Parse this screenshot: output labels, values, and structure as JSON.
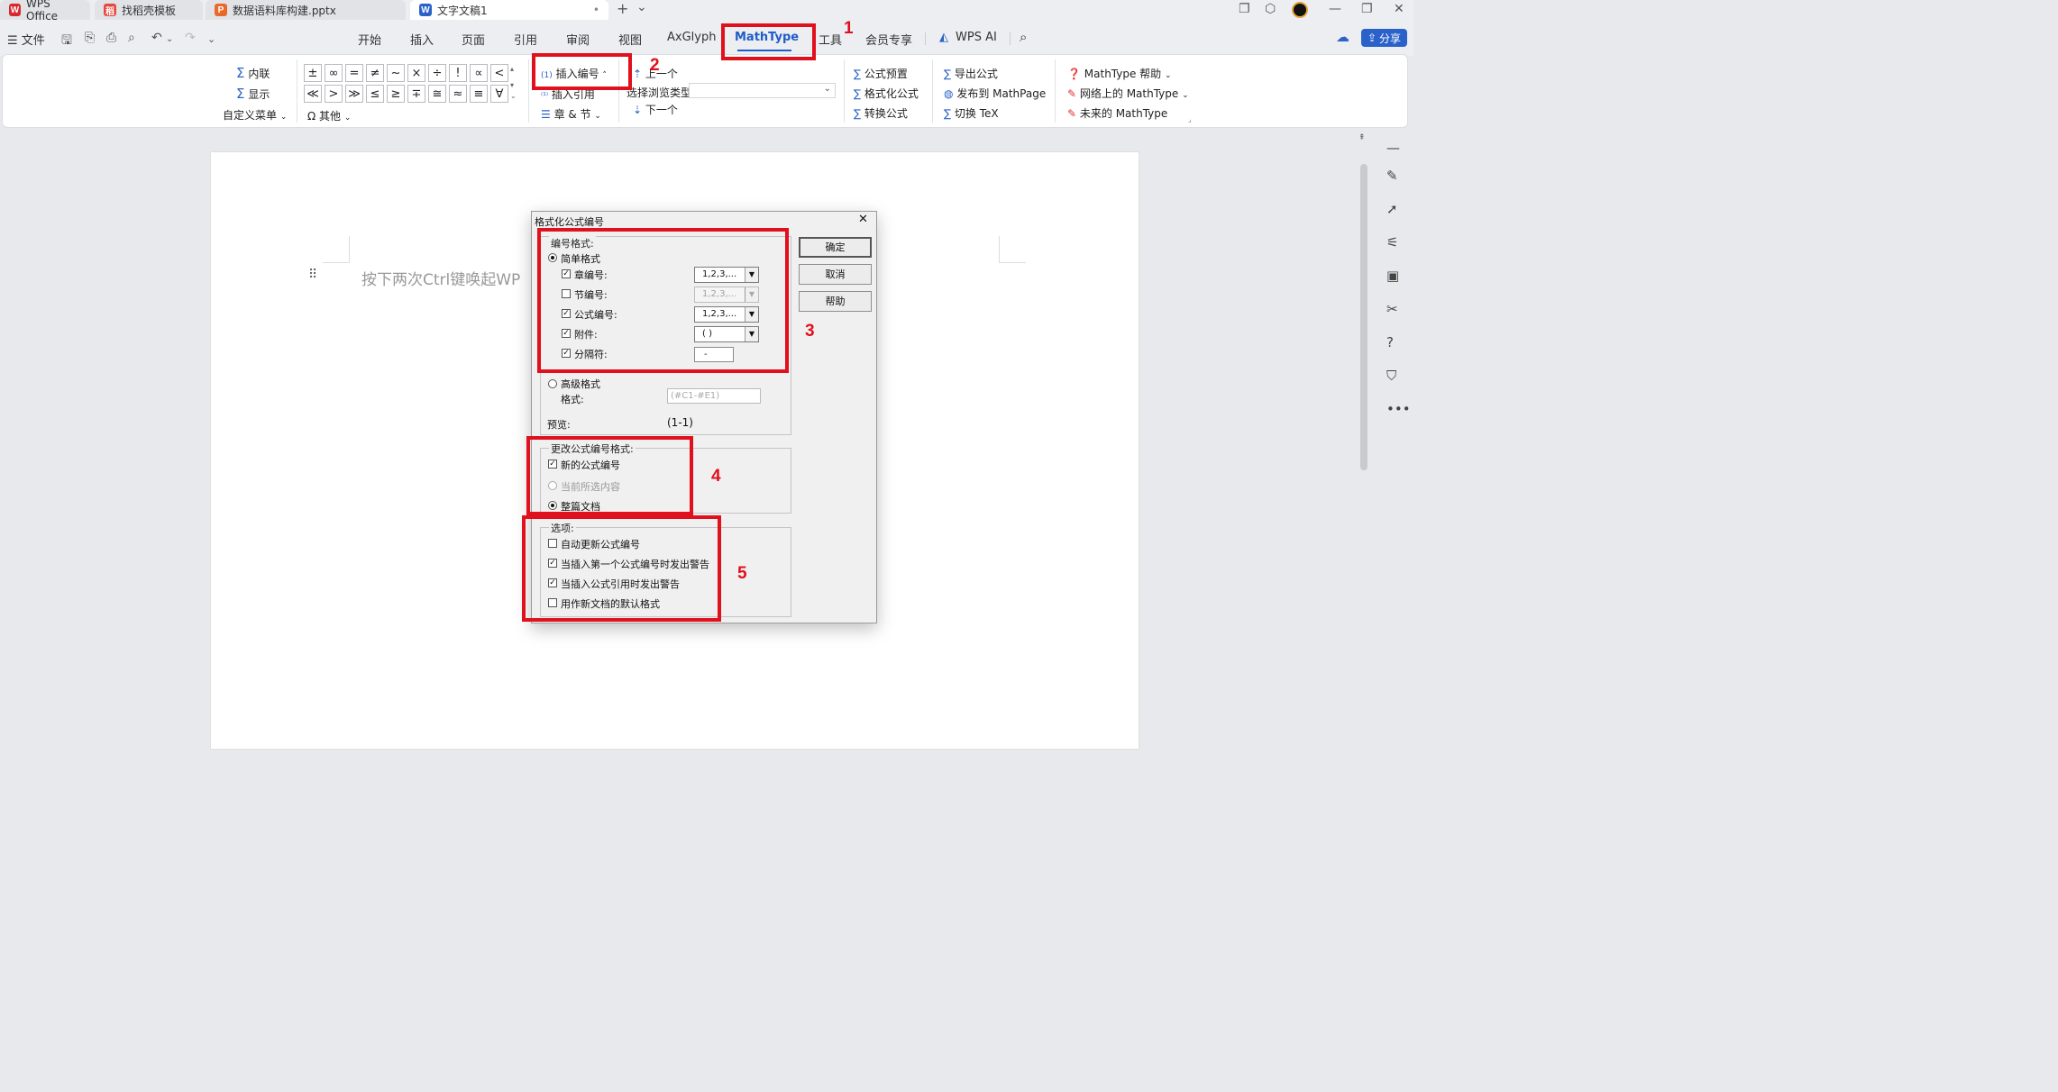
{
  "titlebar": {
    "tabs": [
      {
        "label": "WPS Office",
        "icon": "W"
      },
      {
        "label": "找稻壳模板",
        "icon": "稻"
      },
      {
        "label": "数据语料库构建.pptx",
        "icon": "P"
      },
      {
        "label": "文字文稿1",
        "icon": "W"
      }
    ],
    "new_tab": "+",
    "new_tab_menu": "⌄",
    "active_dot": "•"
  },
  "menubar": {
    "file": "文件",
    "tabs": [
      "开始",
      "插入",
      "页面",
      "引用",
      "审阅",
      "视图",
      "AxGlyph",
      "MathType",
      "工具",
      "会员专享",
      "WPS AI"
    ],
    "share": "分享"
  },
  "ribbon": {
    "inline": "内联",
    "display": "显示",
    "custom_menu": "自定义菜单",
    "symbols_row1": [
      "±",
      "∞",
      "=",
      "≠",
      "~",
      "×",
      "÷",
      "!",
      "∝",
      "<"
    ],
    "symbols_row2": [
      "≪",
      ">",
      "≫",
      "≤",
      "≥",
      "∓",
      "≅",
      "≈",
      "≡",
      "∀"
    ],
    "other": "其他",
    "insert_number": "插入编号",
    "insert_number_prefix": "(1)",
    "insert_reference": "插入引用",
    "chapter_section": "章 & 节",
    "prev": "上一个",
    "browse_type": "选择浏览类型",
    "next": "下一个",
    "formula_preset": "公式预置",
    "format_formula": "格式化公式",
    "convert_formula": "转换公式",
    "export_formula": "导出公式",
    "publish_mathpage": "发布到 MathPage",
    "toggle_tex": "切换 TeX",
    "help": "MathType 帮助",
    "online": "网络上的 MathType",
    "future": "未来的 MathType"
  },
  "document": {
    "placeholder": "按下两次Ctrl键唤起WP"
  },
  "dialog": {
    "title": "格式化公式编号",
    "close": "✕",
    "numbering_format_group": "编号格式:",
    "simple_format": "简单格式",
    "rows": [
      {
        "label": "章编号:",
        "checked": true,
        "value": "1,2,3,...",
        "disabled": false
      },
      {
        "label": "节编号:",
        "checked": false,
        "value": "1,2,3,...",
        "disabled": true
      },
      {
        "label": "公式编号:",
        "checked": true,
        "value": "1,2,3,...",
        "disabled": false
      },
      {
        "label": "附件:",
        "checked": true,
        "value": "( )",
        "disabled": false
      }
    ],
    "separator_label": "分隔符:",
    "separator_value": "-",
    "advanced_format": "高级格式",
    "format_label": "格式:",
    "format_value": "(#C1-#E1)",
    "preview_label": "预览:",
    "preview_value": "(1-1)",
    "change_group": "更改公式编号格式:",
    "new_numbers": "新的公式编号",
    "current_selection": "当前所选内容",
    "whole_document": "整篇文档",
    "options_group": "选项:",
    "options": [
      {
        "label": "自动更新公式编号",
        "checked": false
      },
      {
        "label": "当插入第一个公式编号时发出警告",
        "checked": true
      },
      {
        "label": "当插入公式引用时发出警告",
        "checked": true
      },
      {
        "label": "用作新文档的默认格式",
        "checked": false
      }
    ],
    "ok": "确定",
    "cancel": "取消",
    "help": "帮助"
  },
  "annotations": [
    "1",
    "2",
    "3",
    "4",
    "5"
  ]
}
